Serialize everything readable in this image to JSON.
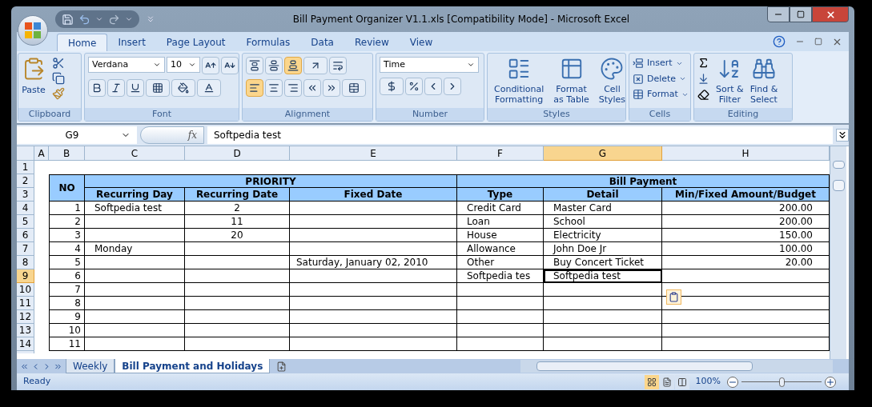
{
  "window": {
    "title": "Bill Payment Organizer V1.1.xls [Compatibility Mode] - Microsoft Excel"
  },
  "ribbon_tabs": [
    {
      "label": "Home",
      "selected": true
    },
    {
      "label": "Insert",
      "selected": false
    },
    {
      "label": "Page Layout",
      "selected": false
    },
    {
      "label": "Formulas",
      "selected": false
    },
    {
      "label": "Data",
      "selected": false
    },
    {
      "label": "Review",
      "selected": false
    },
    {
      "label": "View",
      "selected": false
    }
  ],
  "ribbon_groups": [
    {
      "kind": "clipboard",
      "label": "Clipboard",
      "paste": "Paste"
    },
    {
      "kind": "font",
      "label": "Font",
      "font_name": "Verdana",
      "font_size": "10"
    },
    {
      "kind": "alignment",
      "label": "Alignment",
      "vertical_align": [
        {
          "kind": "top",
          "selected": false
        },
        {
          "kind": "middle",
          "selected": false
        },
        {
          "kind": "bottom",
          "selected": true
        }
      ],
      "horizontal_align": [
        {
          "kind": "left",
          "selected": true
        },
        {
          "kind": "center",
          "selected": false
        },
        {
          "kind": "right",
          "selected": false
        }
      ]
    },
    {
      "kind": "number",
      "label": "Number",
      "format": "Time"
    },
    {
      "kind": "styles",
      "label": "Styles",
      "buttons": [
        {
          "lines": [
            "Conditional",
            "Formatting"
          ]
        },
        {
          "lines": [
            "Format",
            "as Table"
          ]
        },
        {
          "lines": [
            "Cell",
            "Styles"
          ]
        }
      ]
    },
    {
      "kind": "cells",
      "label": "Cells",
      "buttons": [
        "Insert",
        "Delete",
        "Format"
      ]
    },
    {
      "kind": "editing",
      "label": "Editing",
      "buttons": [
        {
          "lines": [
            "Sort &",
            "Filter"
          ]
        },
        {
          "lines": [
            "Find &",
            "Select"
          ]
        }
      ]
    }
  ],
  "formula_bar": {
    "name_box": "G9",
    "fx": "fx",
    "formula": "Softpedia test"
  },
  "columns": [
    {
      "label": "A",
      "selected": false
    },
    {
      "label": "B",
      "selected": false
    },
    {
      "label": "C",
      "selected": false
    },
    {
      "label": "D",
      "selected": false
    },
    {
      "label": "E",
      "selected": false
    },
    {
      "label": "F",
      "selected": false
    },
    {
      "label": "G",
      "selected": true
    },
    {
      "label": "H",
      "selected": false
    }
  ],
  "row_numbers": [
    {
      "label": "1",
      "selected": false
    },
    {
      "label": "2",
      "selected": false
    },
    {
      "label": "3",
      "selected": false
    },
    {
      "label": "4",
      "selected": false
    },
    {
      "label": "5",
      "selected": false
    },
    {
      "label": "6",
      "selected": false
    },
    {
      "label": "7",
      "selected": false
    },
    {
      "label": "8",
      "selected": false
    },
    {
      "label": "9",
      "selected": true
    },
    {
      "label": "10",
      "selected": false
    },
    {
      "label": "11",
      "selected": false
    },
    {
      "label": "12",
      "selected": false
    },
    {
      "label": "13",
      "selected": false
    },
    {
      "label": "14",
      "selected": false
    }
  ],
  "table": {
    "no_header": "NO",
    "groups": [
      "PRIORITY",
      "Bill Payment"
    ],
    "subheaders": [
      "Recurring Day",
      "Recurring Date",
      "Fixed Date",
      "Type",
      "Detail",
      "Min/Fixed Amount/Budget"
    ],
    "rows": [
      {
        "B": "1",
        "C": "Softpedia test",
        "D": "2",
        "F": "Credit Card",
        "G": "Master Card",
        "H": "200.00"
      },
      {
        "B": "2",
        "D": "11",
        "F": "Loan",
        "G": "School",
        "H": "200.00"
      },
      {
        "B": "3",
        "D": "20",
        "F": "House",
        "G": "Electricity",
        "H": "150.00"
      },
      {
        "B": "4",
        "C": "Monday",
        "F": "Allowance",
        "G": "John Doe Jr",
        "H": "100.00"
      },
      {
        "B": "5",
        "E": "Saturday, January 02, 2010",
        "F": "Other",
        "G": "Buy Concert Ticket",
        "H": "20.00"
      },
      {
        "B": "6",
        "F": "Softpedia tes",
        "G": "Softpedia test"
      },
      {
        "B": "7"
      },
      {
        "B": "8"
      },
      {
        "B": "9"
      },
      {
        "B": "10"
      },
      {
        "B": "11"
      }
    ]
  },
  "sheet_tabs": [
    {
      "label": "Weekly",
      "selected": false
    },
    {
      "label": "Bill Payment and Holidays",
      "selected": true
    }
  ],
  "status_bar": {
    "status": "Ready",
    "view_modes": [
      {
        "kind": "normal",
        "selected": true
      },
      {
        "kind": "page-layout",
        "selected": false
      },
      {
        "kind": "page-break",
        "selected": false
      }
    ],
    "zoom": "100%",
    "zoom_slider": {
      "level": 0.5
    }
  }
}
